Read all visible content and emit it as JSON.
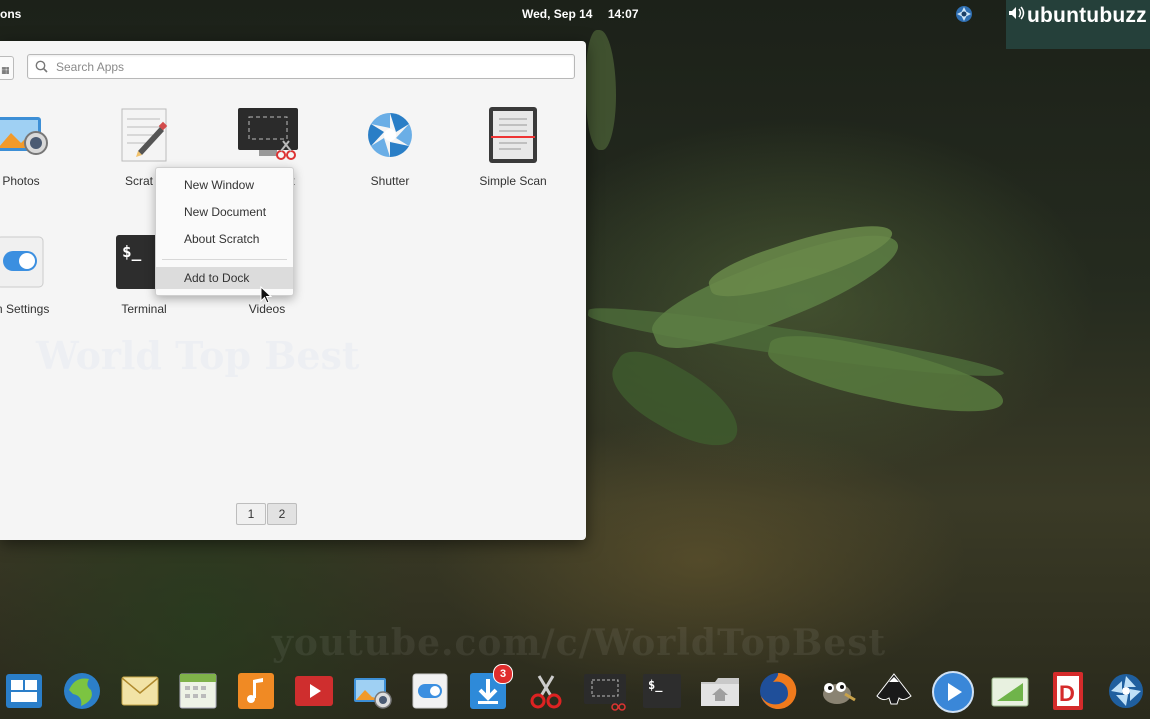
{
  "top_panel": {
    "applications_label": "ons",
    "date": "Wed, Sep 14",
    "time": "14:07",
    "tray_icon": "shutter-icon"
  },
  "brand": {
    "text": "ubuntubuzz",
    "icon": "volume-icon"
  },
  "launcher": {
    "search_placeholder": "Search Apps",
    "apps": [
      {
        "label": "Photos",
        "icon": "photos-icon"
      },
      {
        "label": "Scratch",
        "icon": "scratch-icon"
      },
      {
        "label": "Screenshot",
        "icon": "screenshot-icon"
      },
      {
        "label": "Shutter",
        "icon": "shutter-icon"
      },
      {
        "label": "Simple Scan",
        "icon": "simple-scan-icon"
      },
      {
        "label": "System Settings",
        "icon": "system-settings-icon"
      },
      {
        "label": "Terminal",
        "icon": "terminal-icon"
      },
      {
        "label": "Videos",
        "icon": "videos-icon"
      }
    ],
    "visible_labels": {
      "photos": "Photos",
      "scratch": "Scrat",
      "screenshot": "t",
      "shutter": "Shutter",
      "simple_scan": "Simple Scan",
      "system_settings": "tem Settings",
      "terminal": "Terminal",
      "videos": "Videos"
    },
    "pages": [
      "1",
      "2"
    ]
  },
  "context_menu": {
    "items": [
      "New Window",
      "New Document",
      "About Scratch"
    ],
    "add_to_dock": "Add to Dock"
  },
  "watermarks": {
    "center": "World Top Best",
    "bottom": "youtube.com/c/WorldTopBest"
  },
  "dock": {
    "items": [
      "multitasking-view-icon",
      "web-browser-icon",
      "mail-icon",
      "calendar-icon",
      "music-icon",
      "videos-icon",
      "photos-icon",
      "system-settings-icon",
      "appcenter-icon",
      "screenshot-scissors-icon",
      "screenshot-tool-icon",
      "terminal-icon",
      "files-icon",
      "firefox-icon",
      "gimp-icon",
      "inkscape-icon",
      "media-player-icon",
      "geometry-icon",
      "dict-icon",
      "shutter-icon"
    ],
    "appcenter_badge": "3",
    "accent": "#2d7fd3"
  }
}
